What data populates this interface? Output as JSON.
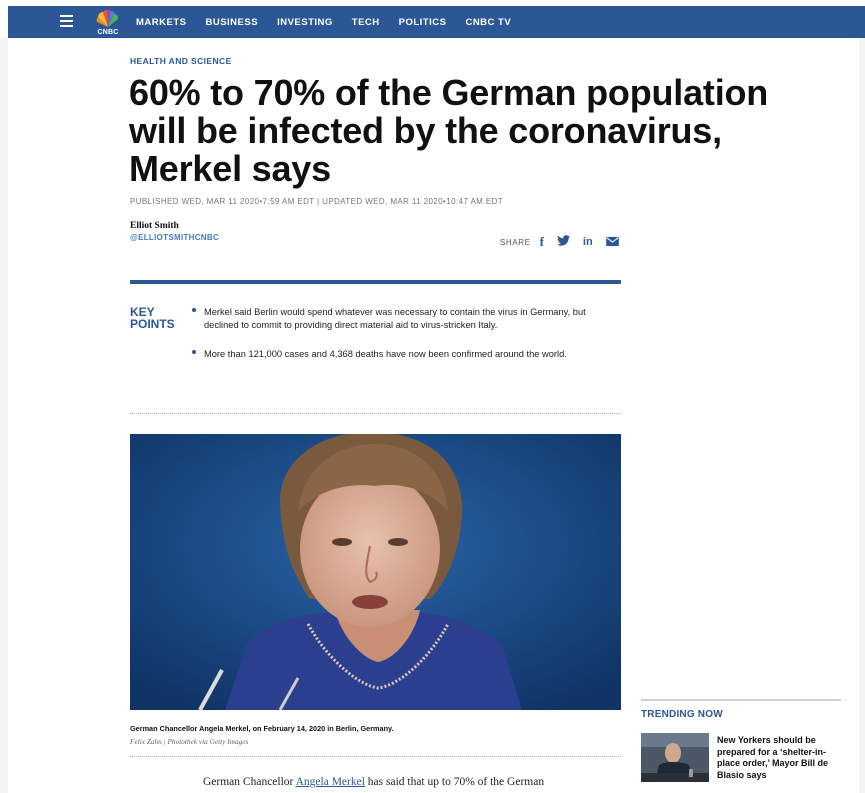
{
  "nav": {
    "logo_text": "CNBC",
    "items": [
      "MARKETS",
      "BUSINESS",
      "INVESTING",
      "TECH",
      "POLITICS",
      "CNBC TV"
    ],
    "bg_color": "#2b5796"
  },
  "article": {
    "kicker": "HEALTH AND SCIENCE",
    "headline": "60% to 70% of the German population will be infected by the coronavirus, Merkel says",
    "dates": "PUBLISHED WED, MAR 11 2020•7:59 AM EDT | UPDATED WED, MAR 11 2020•10:47 AM EDT",
    "author": "Elliot Smith",
    "author_handle": "@ELLIOTSMITHCNBC",
    "share_label": "SHARE",
    "share_icons": [
      "facebook-icon",
      "twitter-icon",
      "linkedin-icon",
      "email-icon"
    ],
    "key_points_label": "KEY POINTS",
    "key_points": [
      "Merkel said Berlin would spend whatever was necessary to contain the virus in Germany, but declined to commit to providing direct material aid to virus-stricken Italy.",
      "More than 121,000 cases and 4,368 deaths have now been confirmed around the world."
    ],
    "photo_caption": "German Chancellor Angela Merkel, on February 14, 2020 in Berlin, Germany.",
    "photo_credit": "Felix Zahn | Photothek via Getty Images",
    "body_before_link": "German Chancellor ",
    "body_link": "Angela Merkel",
    "body_after_link": " has said that up to 70% of the German"
  },
  "trending": {
    "title": "TRENDING NOW",
    "items": [
      {
        "text": "New Yorkers should be prepared for a ‘shelter-in-place order,’ Mayor Bill de Blasio says"
      }
    ]
  },
  "colors": {
    "accent": "#2b5796",
    "link": "#4a7cc0"
  }
}
